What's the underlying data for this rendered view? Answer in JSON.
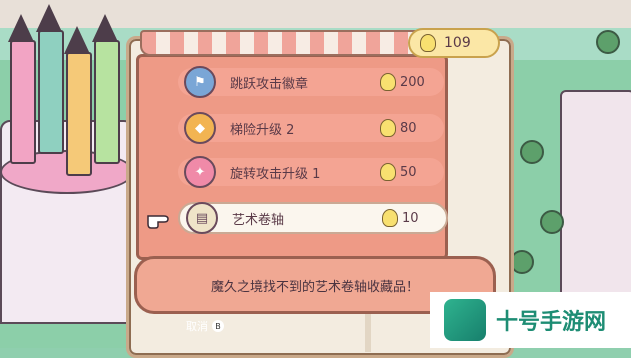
{
  "currency": {
    "value": "109",
    "icon": "lightbulb-icon"
  },
  "upgrades": [
    {
      "name": "跳跃攻击徽章",
      "cost": "200",
      "icon": "badge-icon",
      "selected": false
    },
    {
      "name": "梯险升级 2",
      "cost": "80",
      "icon": "shield-icon",
      "selected": false
    },
    {
      "name": "旋转攻击升级 1",
      "cost": "50",
      "icon": "spin-icon",
      "selected": false
    },
    {
      "name": "艺术卷轴",
      "cost": "10",
      "icon": "scroll-icon",
      "selected": true
    }
  ],
  "description": "魔久之境找不到的艺术卷轴收藏品！",
  "footer": {
    "cancel_label": "取消",
    "cancel_button": "B"
  },
  "brand": {
    "text": "十号手游网"
  },
  "colors": {
    "accent": "#ee9a86",
    "selected_bg": "#fbf6ee",
    "currency_bg": "#fbe7a6"
  }
}
